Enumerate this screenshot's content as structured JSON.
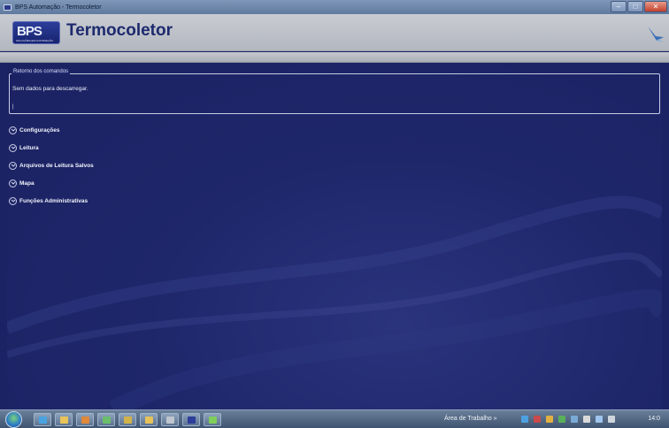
{
  "window": {
    "title": "BPS Automação - Termocoletor"
  },
  "header": {
    "app_title": "Termocoletor",
    "logo_text": "BPS",
    "logo_subtext": "SOLUÇÕES EM AUTOMAÇÃO"
  },
  "commands_panel": {
    "legend": "Retorno dos comandos",
    "message": "Sem dados para descarregar.",
    "caret": "|"
  },
  "menu": {
    "items": [
      {
        "label": "Configurações"
      },
      {
        "label": "Leitura"
      },
      {
        "label": "Arquivos de Leitura Salvos"
      },
      {
        "label": "Mapa"
      },
      {
        "label": "Funções Administrativas"
      }
    ]
  },
  "taskbar": {
    "desktop_label": "Área de Trabalho",
    "desktop_chevron": "»",
    "clock": "14:0"
  },
  "colors": {
    "background": "#1c2364",
    "header": "#c9ccd2",
    "title_text": "#1d2a6e",
    "accent": "#2d3e9a"
  }
}
